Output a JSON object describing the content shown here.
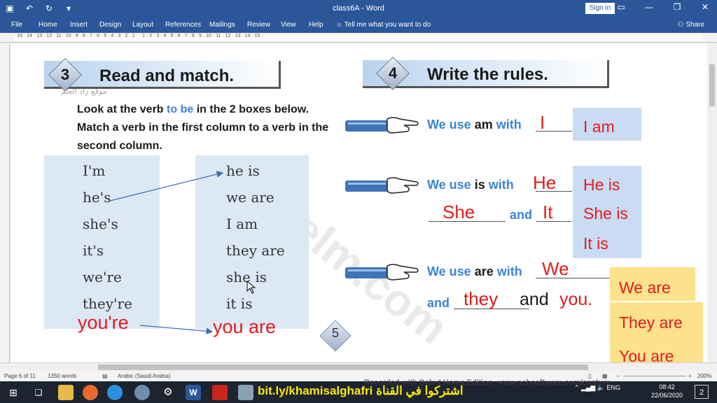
{
  "window": {
    "title": "class6A - Word",
    "signin_label": "Sign in"
  },
  "ribbon": {
    "tabs": [
      "File",
      "Home",
      "Insert",
      "Design",
      "Layout",
      "References",
      "Mailings",
      "Review",
      "View",
      "Help"
    ],
    "tellme": "Tell me what you want to do",
    "share": "Share"
  },
  "ruler_numbers": "· 15 · 14 · 13 · 12 · 11 · 10 · 9 · 8 · 7 · 6 · 5 · 4 · 3 · 2 · 1 · · 1 · 2 · 3 · 4 · 5 · 6 · 7 · 8 · 9 · 10 · 11 · 12 · 13 · 14 · 15 ·",
  "exercise3": {
    "number": "3",
    "title": "Read and match.",
    "instructions_pre": "Look at the verb ",
    "instructions_highlight": "to be",
    "instructions_post": " in the 2 boxes below. Match a verb in the first column to a verb in the second column.",
    "column1": [
      "I'm",
      "he's",
      "she's",
      "it's",
      "we're",
      "they're"
    ],
    "column2": [
      "he is",
      "we are",
      "I am",
      "they are",
      "she is",
      "it is"
    ],
    "handwritten_left": "you're",
    "handwritten_right": "you are",
    "watermark_arabic": "موقع زاد العلم"
  },
  "exercise4": {
    "number": "4",
    "title": "Write the rules.",
    "rule1": {
      "we_use": "We use",
      "verb": "am",
      "with": "with",
      "blank": "I"
    },
    "rule2": {
      "we_use": "We use",
      "verb": "is",
      "with": "with",
      "blank1": "He",
      "blank2": "She",
      "and": "and",
      "blank3": "It"
    },
    "rule3": {
      "we_use": "We use",
      "verb": "are",
      "with": "with",
      "blank1": "We",
      "and1": "and",
      "blank2": "they",
      "tail_and": "and",
      "tail_you": "you."
    },
    "answers1": [
      "I am"
    ],
    "answers2": [
      "He is",
      "She is",
      "It is"
    ],
    "answers3": [
      "We are",
      "They are",
      "You are"
    ]
  },
  "page_number": "5",
  "watermark": "zadelm.com",
  "statusbar": {
    "page": "Page 6 of 11",
    "words": "1350 words",
    "language": "Arabic (Saudi Arabia)",
    "zoom": "200%"
  },
  "taskbar": {
    "channel_text": "bit.ly/khamisalghafri اشتركوا في القناة",
    "recorded": "Recorded with Debut Home Edition. www.nchsoftware.com/capture",
    "lang": "ENG",
    "time": "08:42",
    "date": "22/06/2020",
    "notifications": "2"
  },
  "colors": {
    "word_blue": "#2b579a",
    "handwriting_red": "#e31b1b",
    "rule_blue": "#3a86d4",
    "answer_yellow": "#fde28c",
    "answer_blue": "#c9dcf3"
  }
}
